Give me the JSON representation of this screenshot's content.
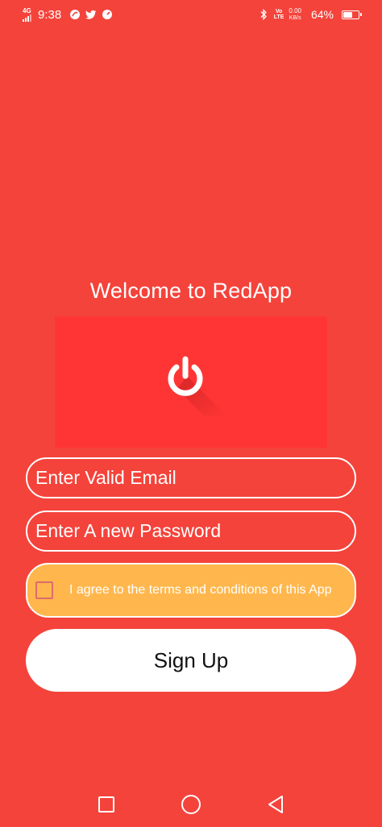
{
  "status_bar": {
    "network": "4G",
    "time": "9:38",
    "volte_top": "Vo",
    "volte_bottom": "LTE",
    "speed_value": "0.00",
    "speed_unit": "KB/s",
    "battery_percent": "64%",
    "battery_level": 0.64
  },
  "welcome_title": "Welcome to RedApp",
  "logo": {
    "icon": "power-icon"
  },
  "form": {
    "email_placeholder": "Enter Valid Email",
    "password_placeholder": "Enter A new Password",
    "terms_label": "I agree to the terms and conditions of this App",
    "terms_checked": false,
    "signup_label": "Sign Up"
  },
  "nav": {
    "recents": "square-icon",
    "home": "circle-icon",
    "back": "triangle-back-icon"
  },
  "colors": {
    "background": "#F4433B",
    "logo_box": "#FF3535",
    "terms_bg": "#FFB74D",
    "button_bg": "#FFFFFF"
  }
}
